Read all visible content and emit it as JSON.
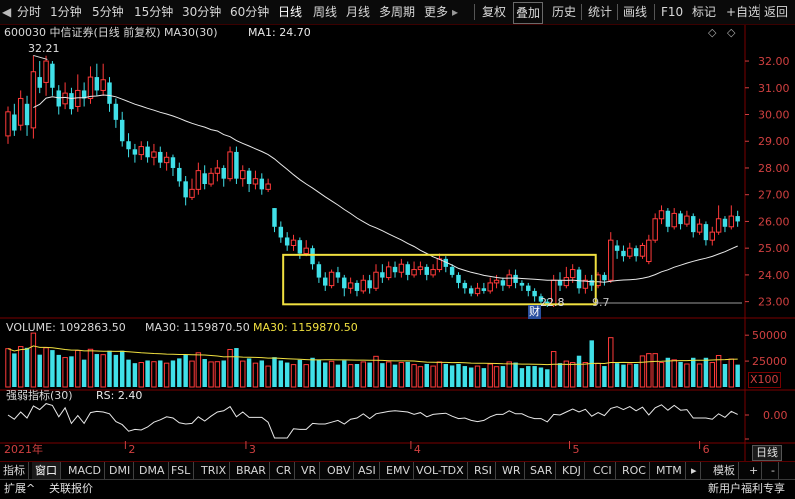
{
  "toolbar": {
    "items": [
      {
        "label": "分时"
      },
      {
        "label": "1分钟"
      },
      {
        "label": "5分钟"
      },
      {
        "label": "15分钟"
      },
      {
        "label": "30分钟"
      },
      {
        "label": "60分钟"
      },
      {
        "label": "日线",
        "active": true
      },
      {
        "label": "周线"
      },
      {
        "label": "月线"
      },
      {
        "label": "多周期"
      },
      {
        "label": "更多"
      }
    ],
    "right_items": [
      {
        "label": "复权"
      },
      {
        "label": "叠加"
      },
      {
        "label": "历史"
      },
      {
        "label": "统计"
      },
      {
        "label": "画线"
      },
      {
        "label": "F10"
      },
      {
        "label": "标记"
      },
      {
        "label": "+自选"
      },
      {
        "label": "返回"
      }
    ],
    "back_arrow": "◀",
    "more_arrow": "▸"
  },
  "info": {
    "code_name": "600030 中信证券(日线 前复权)",
    "ma30": "MA30(30)",
    "ma1": "MA1: 24.70",
    "diamond": "◇",
    "collapse": "◇"
  },
  "price_axis": [
    "32.00",
    "31.00",
    "30.00",
    "29.00",
    "28.00",
    "27.00",
    "26.00",
    "25.00",
    "24.00",
    "23.00"
  ],
  "high_label": "32.21",
  "low_label": "22.8",
  "low_label_extra": "9.7",
  "cai_badge": "财",
  "volume": {
    "label": "VOLUME: 1092863.50",
    "ma30_label": "MA30: 1159870.50",
    "ma30_label2": "MA30: 1159870.50",
    "axis": [
      "50000",
      "25000"
    ],
    "unit": "X100"
  },
  "rsi": {
    "label": "强弱指标(30)",
    "rs_label": "RS: 2.40",
    "axis": [
      "0.00",
      "-0.00"
    ]
  },
  "time_axis": [
    {
      "label": "2021年"
    },
    {
      "label": "2"
    },
    {
      "label": "3"
    },
    {
      "label": "4"
    },
    {
      "label": "5"
    },
    {
      "label": "6"
    }
  ],
  "period_badge": "日线",
  "indicator_tabs": [
    {
      "label": "指标"
    },
    {
      "label": "窗口"
    },
    {
      "label": "MACD"
    },
    {
      "label": "DMI"
    },
    {
      "label": "DMA"
    },
    {
      "label": "FSL"
    },
    {
      "label": "TRIX"
    },
    {
      "label": "BRAR"
    },
    {
      "label": "CR"
    },
    {
      "label": "VR"
    },
    {
      "label": "OBV"
    },
    {
      "label": "ASI"
    },
    {
      "label": "EMV"
    },
    {
      "label": "VOL-TDX"
    },
    {
      "label": "RSI"
    },
    {
      "label": "WR"
    },
    {
      "label": "SAR"
    },
    {
      "label": "KDJ"
    },
    {
      "label": "CCI"
    },
    {
      "label": "ROC"
    },
    {
      "label": "MTM"
    },
    {
      "label": "▸"
    },
    {
      "label": "模板"
    },
    {
      "label": "+"
    },
    {
      "label": "-"
    }
  ],
  "status": {
    "left1": "扩展^",
    "left2": "关联报价",
    "right": "新用户福利专享"
  },
  "colors": {
    "up": "#ff3a3a",
    "down": "#40e0e8",
    "ma": "#e8e8e8",
    "highlight_box": "#f0e040",
    "grid": "#7a0000",
    "axis_text": "#d04040"
  },
  "chart_data": {
    "type": "candlestick",
    "ylim": [
      22.5,
      32.6
    ],
    "candles": [
      {
        "o": 29.2,
        "c": 30.1,
        "h": 30.3,
        "l": 28.9
      },
      {
        "o": 30.0,
        "c": 29.4,
        "h": 30.4,
        "l": 29.2
      },
      {
        "o": 29.6,
        "c": 30.6,
        "h": 30.9,
        "l": 29.4
      },
      {
        "o": 30.4,
        "c": 29.6,
        "h": 30.7,
        "l": 29.2
      },
      {
        "o": 29.5,
        "c": 31.6,
        "h": 32.21,
        "l": 29.1
      },
      {
        "o": 31.4,
        "c": 31.0,
        "h": 32.0,
        "l": 30.8
      },
      {
        "o": 31.2,
        "c": 32.0,
        "h": 32.2,
        "l": 30.7
      },
      {
        "o": 31.9,
        "c": 31.0,
        "h": 32.0,
        "l": 30.7
      },
      {
        "o": 30.9,
        "c": 30.3,
        "h": 31.1,
        "l": 30.0
      },
      {
        "o": 30.4,
        "c": 30.8,
        "h": 31.2,
        "l": 30.2
      },
      {
        "o": 30.8,
        "c": 30.2,
        "h": 31.0,
        "l": 30.0
      },
      {
        "o": 30.3,
        "c": 30.9,
        "h": 31.5,
        "l": 30.1
      },
      {
        "o": 30.9,
        "c": 30.6,
        "h": 31.2,
        "l": 30.3
      },
      {
        "o": 30.6,
        "c": 31.4,
        "h": 31.8,
        "l": 30.4
      },
      {
        "o": 31.4,
        "c": 30.9,
        "h": 31.9,
        "l": 30.7
      },
      {
        "o": 30.9,
        "c": 31.3,
        "h": 31.9,
        "l": 30.7
      },
      {
        "o": 31.2,
        "c": 30.4,
        "h": 31.4,
        "l": 30.1
      },
      {
        "o": 30.4,
        "c": 29.8,
        "h": 30.6,
        "l": 29.5
      },
      {
        "o": 29.8,
        "c": 29.0,
        "h": 30.1,
        "l": 28.8
      },
      {
        "o": 29.0,
        "c": 28.7,
        "h": 29.3,
        "l": 28.4
      },
      {
        "o": 28.7,
        "c": 28.5,
        "h": 28.9,
        "l": 28.2
      },
      {
        "o": 28.5,
        "c": 28.8,
        "h": 29.0,
        "l": 28.3
      },
      {
        "o": 28.8,
        "c": 28.4,
        "h": 29.0,
        "l": 28.2
      },
      {
        "o": 28.4,
        "c": 28.6,
        "h": 28.9,
        "l": 28.1
      },
      {
        "o": 28.6,
        "c": 28.2,
        "h": 28.8,
        "l": 28.0
      },
      {
        "o": 28.2,
        "c": 28.4,
        "h": 28.6,
        "l": 27.9
      },
      {
        "o": 28.4,
        "c": 28.0,
        "h": 28.5,
        "l": 27.7
      },
      {
        "o": 28.0,
        "c": 27.5,
        "h": 28.2,
        "l": 27.3
      },
      {
        "o": 27.5,
        "c": 26.9,
        "h": 27.7,
        "l": 26.6
      },
      {
        "o": 26.9,
        "c": 27.2,
        "h": 27.6,
        "l": 26.8
      },
      {
        "o": 27.2,
        "c": 27.9,
        "h": 28.2,
        "l": 27.0
      },
      {
        "o": 27.8,
        "c": 27.4,
        "h": 28.1,
        "l": 27.2
      },
      {
        "o": 27.4,
        "c": 27.8,
        "h": 28.0,
        "l": 27.3
      },
      {
        "o": 27.8,
        "c": 28.0,
        "h": 28.3,
        "l": 27.5
      },
      {
        "o": 28.0,
        "c": 27.6,
        "h": 28.1,
        "l": 27.3
      },
      {
        "o": 27.6,
        "c": 28.6,
        "h": 28.8,
        "l": 27.5
      },
      {
        "o": 28.6,
        "c": 27.6,
        "h": 28.8,
        "l": 27.4
      },
      {
        "o": 27.6,
        "c": 27.9,
        "h": 28.1,
        "l": 27.3
      },
      {
        "o": 27.9,
        "c": 27.4,
        "h": 28.0,
        "l": 27.1
      },
      {
        "o": 27.4,
        "c": 27.6,
        "h": 27.9,
        "l": 27.2
      },
      {
        "o": 27.6,
        "c": 27.2,
        "h": 27.8,
        "l": 27.0
      },
      {
        "o": 27.2,
        "c": 27.4,
        "h": 27.6,
        "l": 27.1
      },
      {
        "o": 26.5,
        "c": 25.8,
        "h": 26.5,
        "l": 25.6
      },
      {
        "o": 25.8,
        "c": 25.4,
        "h": 26.0,
        "l": 25.2
      },
      {
        "o": 25.4,
        "c": 25.1,
        "h": 25.6,
        "l": 24.9
      },
      {
        "o": 25.1,
        "c": 25.3,
        "h": 25.5,
        "l": 24.9
      },
      {
        "o": 25.3,
        "c": 24.8,
        "h": 25.4,
        "l": 24.6
      },
      {
        "o": 24.8,
        "c": 25.0,
        "h": 25.3,
        "l": 24.7
      },
      {
        "o": 25.0,
        "c": 24.4,
        "h": 25.1,
        "l": 24.2
      },
      {
        "o": 24.4,
        "c": 23.9,
        "h": 24.5,
        "l": 23.7
      },
      {
        "o": 23.9,
        "c": 23.6,
        "h": 24.1,
        "l": 23.4
      },
      {
        "o": 23.6,
        "c": 24.1,
        "h": 24.2,
        "l": 23.5
      },
      {
        "o": 24.1,
        "c": 23.9,
        "h": 24.3,
        "l": 23.7
      },
      {
        "o": 23.9,
        "c": 23.5,
        "h": 24.0,
        "l": 23.2
      },
      {
        "o": 23.5,
        "c": 23.7,
        "h": 23.9,
        "l": 23.3
      },
      {
        "o": 23.7,
        "c": 23.4,
        "h": 23.8,
        "l": 23.2
      },
      {
        "o": 23.4,
        "c": 23.8,
        "h": 24.0,
        "l": 23.3
      },
      {
        "o": 23.8,
        "c": 23.5,
        "h": 24.0,
        "l": 23.3
      },
      {
        "o": 23.5,
        "c": 24.1,
        "h": 24.4,
        "l": 23.4
      },
      {
        "o": 24.1,
        "c": 23.9,
        "h": 24.4,
        "l": 23.7
      },
      {
        "o": 23.9,
        "c": 24.3,
        "h": 24.5,
        "l": 23.8
      },
      {
        "o": 24.3,
        "c": 24.1,
        "h": 24.5,
        "l": 23.9
      },
      {
        "o": 24.1,
        "c": 24.4,
        "h": 24.6,
        "l": 23.9
      },
      {
        "o": 24.4,
        "c": 24.0,
        "h": 24.5,
        "l": 23.8
      },
      {
        "o": 24.0,
        "c": 24.2,
        "h": 24.5,
        "l": 23.9
      },
      {
        "o": 24.2,
        "c": 24.3,
        "h": 24.5,
        "l": 24.0
      },
      {
        "o": 24.3,
        "c": 24.0,
        "h": 24.4,
        "l": 23.8
      },
      {
        "o": 24.0,
        "c": 24.2,
        "h": 24.4,
        "l": 23.9
      },
      {
        "o": 24.2,
        "c": 24.6,
        "h": 24.8,
        "l": 24.1
      },
      {
        "o": 24.6,
        "c": 24.3,
        "h": 24.7,
        "l": 24.1
      },
      {
        "o": 24.3,
        "c": 24.0,
        "h": 24.4,
        "l": 23.9
      },
      {
        "o": 24.0,
        "c": 23.7,
        "h": 24.1,
        "l": 23.5
      },
      {
        "o": 23.7,
        "c": 23.5,
        "h": 23.8,
        "l": 23.3
      },
      {
        "o": 23.5,
        "c": 23.3,
        "h": 23.6,
        "l": 23.2
      },
      {
        "o": 23.3,
        "c": 23.5,
        "h": 23.7,
        "l": 23.2
      },
      {
        "o": 23.5,
        "c": 23.4,
        "h": 23.7,
        "l": 23.3
      },
      {
        "o": 23.4,
        "c": 23.7,
        "h": 23.9,
        "l": 23.3
      },
      {
        "o": 23.7,
        "c": 23.8,
        "h": 24.0,
        "l": 23.5
      },
      {
        "o": 23.8,
        "c": 23.6,
        "h": 23.9,
        "l": 23.4
      },
      {
        "o": 23.6,
        "c": 24.0,
        "h": 24.2,
        "l": 23.5
      },
      {
        "o": 24.0,
        "c": 23.7,
        "h": 24.2,
        "l": 23.5
      },
      {
        "o": 23.7,
        "c": 23.6,
        "h": 23.8,
        "l": 23.4
      },
      {
        "o": 23.6,
        "c": 23.4,
        "h": 23.7,
        "l": 23.2
      },
      {
        "o": 23.4,
        "c": 23.2,
        "h": 23.5,
        "l": 23.0
      },
      {
        "o": 23.2,
        "c": 23.0,
        "h": 23.3,
        "l": 22.9
      },
      {
        "o": 23.0,
        "c": 22.85,
        "h": 23.1,
        "l": 22.8
      },
      {
        "o": 22.9,
        "c": 23.8,
        "h": 24.0,
        "l": 22.8
      },
      {
        "o": 23.8,
        "c": 23.6,
        "h": 24.1,
        "l": 23.4
      },
      {
        "o": 23.6,
        "c": 23.9,
        "h": 24.3,
        "l": 23.5
      },
      {
        "o": 23.9,
        "c": 24.2,
        "h": 24.4,
        "l": 23.7
      },
      {
        "o": 24.2,
        "c": 23.5,
        "h": 24.3,
        "l": 23.3
      },
      {
        "o": 23.5,
        "c": 23.8,
        "h": 24.0,
        "l": 23.3
      },
      {
        "o": 23.8,
        "c": 23.6,
        "h": 24.0,
        "l": 23.4
      },
      {
        "o": 23.6,
        "c": 24.0,
        "h": 24.1,
        "l": 23.5
      },
      {
        "o": 24.0,
        "c": 23.8,
        "h": 24.1,
        "l": 23.6
      },
      {
        "o": 23.8,
        "c": 25.3,
        "h": 25.6,
        "l": 23.7
      },
      {
        "o": 25.1,
        "c": 24.9,
        "h": 25.3,
        "l": 24.6
      },
      {
        "o": 24.9,
        "c": 24.7,
        "h": 25.1,
        "l": 24.5
      },
      {
        "o": 24.7,
        "c": 25.0,
        "h": 25.2,
        "l": 24.6
      },
      {
        "o": 25.0,
        "c": 24.7,
        "h": 25.1,
        "l": 24.5
      },
      {
        "o": 24.7,
        "c": 25.1,
        "h": 25.2,
        "l": 24.6
      },
      {
        "o": 24.5,
        "c": 25.3,
        "h": 25.5,
        "l": 24.4
      },
      {
        "o": 25.3,
        "c": 26.1,
        "h": 26.3,
        "l": 25.2
      },
      {
        "o": 26.1,
        "c": 26.4,
        "h": 26.6,
        "l": 25.9
      },
      {
        "o": 26.4,
        "c": 25.8,
        "h": 26.5,
        "l": 25.6
      },
      {
        "o": 25.8,
        "c": 26.3,
        "h": 26.5,
        "l": 25.7
      },
      {
        "o": 26.3,
        "c": 25.9,
        "h": 26.4,
        "l": 25.7
      },
      {
        "o": 25.9,
        "c": 26.2,
        "h": 26.4,
        "l": 25.8
      },
      {
        "o": 26.2,
        "c": 25.6,
        "h": 26.3,
        "l": 25.4
      },
      {
        "o": 25.6,
        "c": 25.9,
        "h": 26.1,
        "l": 25.5
      },
      {
        "o": 25.9,
        "c": 25.3,
        "h": 26.0,
        "l": 25.1
      },
      {
        "o": 25.3,
        "c": 25.6,
        "h": 25.8,
        "l": 25.1
      },
      {
        "o": 25.6,
        "c": 26.1,
        "h": 26.6,
        "l": 25.5
      },
      {
        "o": 26.1,
        "c": 25.8,
        "h": 26.2,
        "l": 25.6
      },
      {
        "o": 25.8,
        "c": 26.2,
        "h": 26.6,
        "l": 25.7
      },
      {
        "o": 26.2,
        "c": 26.0,
        "h": 26.4,
        "l": 25.8
      }
    ],
    "volume_max": 55000,
    "highlight_box": {
      "i0": 44,
      "i1": 92,
      "ylo": 22.9,
      "yhi": 24.75
    },
    "marker_line_price": 22.95
  }
}
